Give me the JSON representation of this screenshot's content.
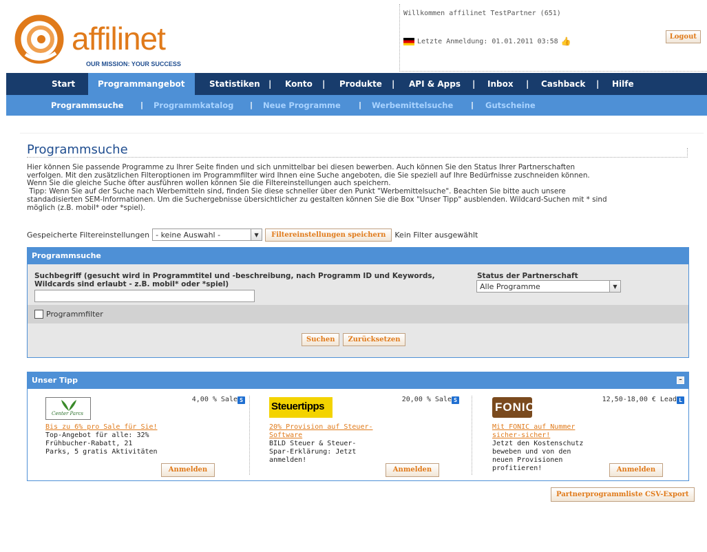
{
  "header": {
    "logo_text": "affilinet",
    "logo_tagline": "OUR MISSION: YOUR SUCCESS",
    "welcome": "Willkommen affilinet TestPartner (651)",
    "last_login": "Letzte Anmeldung: 01.01.2011 03:58",
    "logout_label": "Logout"
  },
  "main_nav": {
    "items": [
      "Start",
      "Programmangebot",
      "Statistiken",
      "Konto",
      "Produkte",
      "API & Apps",
      "Inbox",
      "Cashback",
      "Hilfe"
    ],
    "active": "Programmangebot"
  },
  "sub_nav": {
    "items": [
      "Programmsuche",
      "Programmkatalog",
      "Neue Programme",
      "Werbemittelsuche",
      "Gutscheine"
    ],
    "active": "Programmsuche"
  },
  "page": {
    "title": "Programmsuche",
    "intro_lines": [
      "Hier können Sie passende Programme zu Ihrer Seite finden und sich unmittelbar bei diesen bewerben. Auch können Sie den Status Ihrer Partnerschaften",
      "verfolgen. Mit den zusätzlichen Filteroptionen im Programmfilter wird Ihnen eine Suche angeboten, die Sie speziell auf Ihre Bedürfnisse zuschneiden können.",
      "Wenn Sie die gleiche Suche öfter ausführen wollen können Sie die Filtereinstellungen auch speichern.",
      " Tipp: Wenn Sie auf der Suche nach Werbemitteln sind, finden Sie diese schneller über den Punkt \"Werbemittelsuche\". Beachten Sie bitte auch unsere",
      "standadisierten SEM-Informationen. Um die Suchergebnisse übersichtlicher zu gestalten können Sie die Box \"Unser Tipp\" ausblenden. Wildcard-Suchen mit * sind",
      "möglich (z.B. mobil* oder *spiel)."
    ]
  },
  "saved_filters": {
    "label": "Gespeicherte Filtereinstellungen",
    "selected": "- keine Auswahl -",
    "save_button": "Filtereinstellungen speichern",
    "status": "Kein Filter ausgewählt"
  },
  "search_panel": {
    "title": "Programmsuche",
    "term_label_line1": "Suchbegriff (gesucht wird in Programmtitel und -beschreibung, nach Programm ID und Keywords,",
    "term_label_line2": "Wildcards sind erlaubt - z.B. mobil* oder *spiel)",
    "term_value": "",
    "status_label": "Status der Partnerschaft",
    "status_selected": "Alle Programme",
    "filter_checkbox_label": "Programmfilter",
    "search_button": "Suchen",
    "reset_button": "Zurücksetzen"
  },
  "tips_panel": {
    "title": "Unser Tipp",
    "collapse_icon": "minus-box-icon",
    "items": [
      {
        "logo": "Center Parcs",
        "price": "4,00  % Sale",
        "badge": "S",
        "link_lines": [
          "Bis zu 6% pro Sale für Sie!"
        ],
        "desc_lines": [
          "Top-Angebot für alle: 32%",
          "Frühbucher-Rabatt, 21",
          "Parks, 5 gratis Aktivitäten"
        ],
        "button": "Anmelden"
      },
      {
        "logo": "Steuertipps",
        "price": "20,00  % Sale",
        "badge": "S",
        "link_lines": [
          "20% Provision auf Steuer-",
          "Software"
        ],
        "desc_lines": [
          "BILD Steuer & Steuer-",
          "Spar-Erklärung: Jetzt",
          "anmelden!"
        ],
        "button": "Anmelden"
      },
      {
        "logo": "FONIC",
        "price": "12,50-18,00 € Lead",
        "badge": "L",
        "link_lines": [
          "Mit FONIC auf Nummer",
          "sicher-sicher!"
        ],
        "desc_lines": [
          "Jetzt den Kostenschutz",
          "beweben und von den",
          "neuen Provisionen",
          "profitieren!"
        ],
        "button": "Anmelden"
      }
    ]
  },
  "export_button": "Partnerprogrammliste CSV-Export",
  "colors": {
    "nav_dark": "#183c6c",
    "nav_light": "#4e90d6",
    "accent_orange": "#e07a1a",
    "title_blue": "#1f4d8f"
  }
}
